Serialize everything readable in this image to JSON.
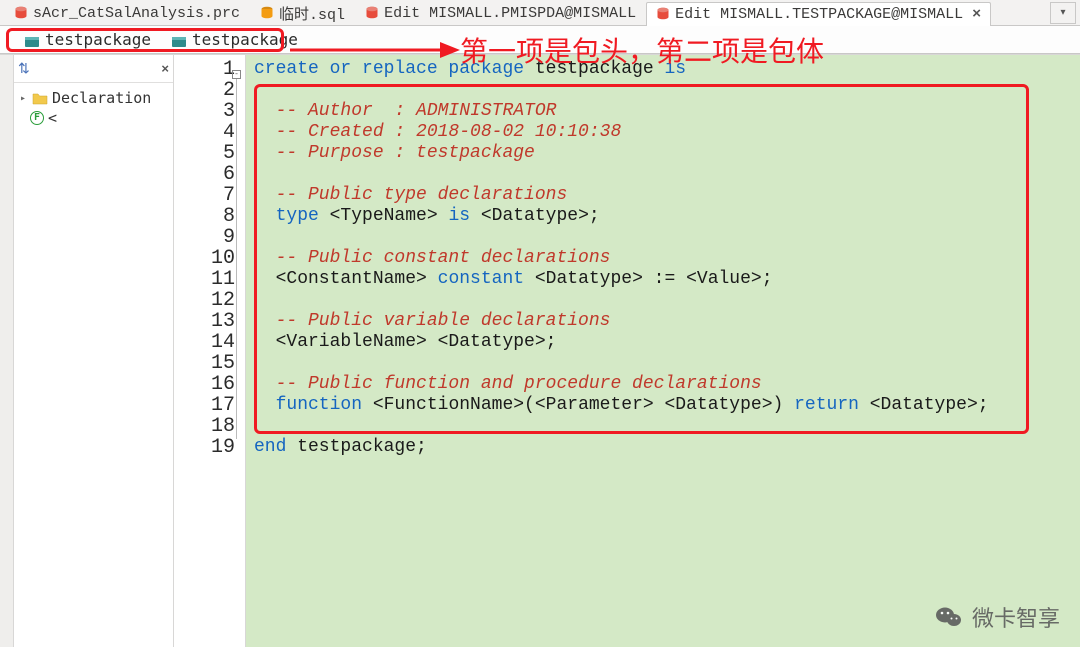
{
  "tabs": [
    {
      "label": "sAcr_CatSalAnalysis.prc",
      "icon": "db-red"
    },
    {
      "label": "临时.sql",
      "icon": "db-orange"
    },
    {
      "label": "Edit MISMALL.PMISPDA@MISMALL",
      "icon": "db-red"
    },
    {
      "label": "Edit MISMALL.TESTPACKAGE@MISMALL",
      "icon": "db-red",
      "active": true,
      "closable": true
    }
  ],
  "sub_tabs": [
    {
      "label": "testpackage",
      "icon": "pkg"
    },
    {
      "label": "testpackage",
      "icon": "pkg"
    }
  ],
  "annotation": "第一项是包头，第二项是包体",
  "sidebar": {
    "close": "×",
    "tree": {
      "root_label": "Declaration",
      "func_symbol": "F",
      "func_tail": " <"
    }
  },
  "line_numbers": [
    "1",
    "2",
    "3",
    "4",
    "5",
    "6",
    "7",
    "8",
    "9",
    "10",
    "11",
    "12",
    "13",
    "14",
    "15",
    "16",
    "17",
    "18",
    "19"
  ],
  "code": {
    "l1": {
      "a": "create or replace package",
      "b": " testpackage ",
      "c": "is"
    },
    "l3c": "  -- Author  : ADMINISTRATOR",
    "l4c": "  -- Created : 2018-08-02 10:10:38",
    "l5c": "  -- Purpose : testpackage",
    "l7c": "  -- Public type declarations",
    "l8": {
      "a": "  type",
      "b": " <TypeName> ",
      "c": "is",
      "d": " <Datatype>;"
    },
    "l10c": "  -- Public constant declarations",
    "l11": {
      "a": "  <ConstantName> ",
      "b": "constant",
      "c": " <Datatype> := <Value>;"
    },
    "l13c": "  -- Public variable declarations",
    "l14": "  <VariableName> <Datatype>;",
    "l16c": "  -- Public function and procedure declarations",
    "l17": {
      "a": "  function",
      "b": " <FunctionName>(<Parameter> <Datatype>) ",
      "c": "return",
      "d": " <Datatype>;"
    },
    "l19": {
      "a": "end",
      "b": " testpackage;"
    }
  },
  "watermark": "微卡智享"
}
